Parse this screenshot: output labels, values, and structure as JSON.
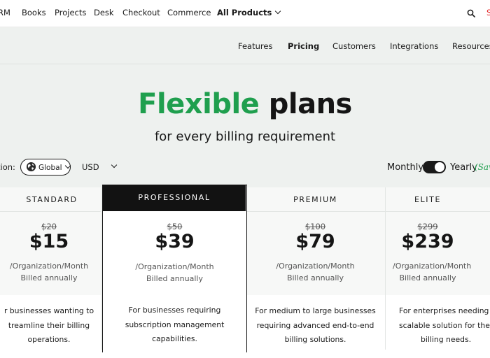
{
  "top_nav": {
    "items": [
      "RM",
      "Books",
      "Projects",
      "Desk",
      "Checkout",
      "Commerce",
      "All Products"
    ],
    "signin_fragment": "S"
  },
  "sub_nav": [
    "Features",
    "Pricing",
    "Customers",
    "Integrations",
    "Resources"
  ],
  "hero": {
    "title_green": "Flexible",
    "title_black": "plans",
    "subtitle": "for every billing requirement"
  },
  "controls": {
    "region_label": "tion:",
    "region_value": "Global",
    "currency": "USD",
    "billing_monthly": "Monthly",
    "billing_yearly": "Yearly",
    "save_tag": "(Sav",
    "yearly_selected": true
  },
  "plans": [
    {
      "name": "STANDARD",
      "old_price": "$20",
      "price": "$15",
      "per": "/Organization/Month",
      "billed": "Billed annually",
      "desc": [
        "r businesses wanting to",
        "treamline their billing",
        "operations."
      ]
    },
    {
      "name": "PROFESSIONAL",
      "old_price": "$50",
      "price": "$39",
      "per": "/Organization/Month",
      "billed": "Billed annually",
      "desc": [
        "For businesses requiring",
        "subscription management",
        "capabilities."
      ]
    },
    {
      "name": "PREMIUM",
      "old_price": "$100",
      "price": "$79",
      "per": "/Organization/Month",
      "billed": "Billed annually",
      "desc": [
        "For medium to large businesses",
        "requiring advanced end-to-end",
        "billing solutions."
      ]
    },
    {
      "name": "ELITE",
      "old_price": "$299",
      "price": "$239",
      "per": "/Organization/Month",
      "billed": "Billed annually",
      "desc": [
        "For enterprises needing a cu",
        "scalable solution for their co",
        "billing needs."
      ]
    }
  ],
  "colors": {
    "accent_green": "#1f9f4e",
    "brand_red": "#e42527",
    "hero_background": "#eef1ef",
    "featured_header": "#121212"
  }
}
